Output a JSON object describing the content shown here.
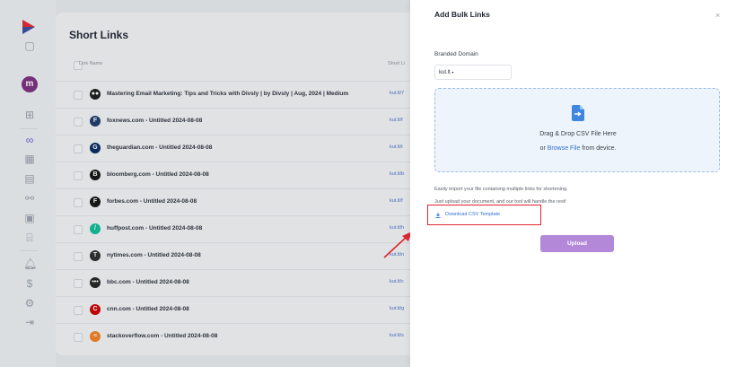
{
  "sidebar": {
    "avatar_letter": "m",
    "dollar_glyph": "$"
  },
  "page": {
    "title": "Short Links",
    "col_link_name": "Link Name",
    "col_short_link": "Short Li"
  },
  "rows": [
    {
      "name": "Mastering Email Marketing: Tips and Tricks with Divsly | by Divsly | Aug, 2024 | Medium",
      "url": "kut.lt/7",
      "icon": "medium-icon",
      "color": "#1a1a1a",
      "glyph": "●●"
    },
    {
      "name": "foxnews.com - Untitled 2024-08-08",
      "url": "kut.lt/f",
      "icon": "foxnews-icon",
      "color": "#1b3a6b",
      "glyph": "F"
    },
    {
      "name": "theguardian.com - Untitled 2024-08-08",
      "url": "kut.lt/t",
      "icon": "guardian-icon",
      "color": "#052962",
      "glyph": "G"
    },
    {
      "name": "bloomberg.com - Untitled 2024-08-08",
      "url": "kut.lt/b",
      "icon": "bloomberg-icon",
      "color": "#111111",
      "glyph": "B"
    },
    {
      "name": "forbes.com - Untitled 2024-08-08",
      "url": "kut.lt/f",
      "icon": "forbes-icon",
      "color": "#111111",
      "glyph": "F"
    },
    {
      "name": "huffpost.com - Untitled 2024-08-08",
      "url": "kut.lt/h",
      "icon": "huffpost-icon",
      "color": "#0dbe98",
      "glyph": "/"
    },
    {
      "name": "nytimes.com - Untitled 2024-08-08",
      "url": "kut.lt/n",
      "icon": "nytimes-icon",
      "color": "#2b2b2b",
      "glyph": "T"
    },
    {
      "name": "bbc.com - Untitled 2024-08-08",
      "url": "kut.lt/c",
      "icon": "bbc-icon",
      "color": "#222222",
      "glyph": "•••"
    },
    {
      "name": "cnn.com - Untitled 2024-08-08",
      "url": "kut.lt/g",
      "icon": "cnn-icon",
      "color": "#cc0000",
      "glyph": "C"
    },
    {
      "name": "stackoverflow.com - Untitled 2024-08-08",
      "url": "kut.lt/s",
      "icon": "stackoverflow-icon",
      "color": "#f48024",
      "glyph": "≡"
    }
  ],
  "drawer": {
    "title": "Add Bulk Links",
    "close_glyph": "×",
    "domain_label": "Branded Domain",
    "domain_value": "kut.lt",
    "domain_caret": "▾",
    "dropzone_line1": "Drag & Drop CSV File Here",
    "dropzone_prefix": "or",
    "browse_label": "Browse File",
    "dropzone_suffix": "from device.",
    "hint_line1": "Easily import your file containing multiple links for shortening.",
    "hint_line2": "Just upload your document, and our tool will handle the rest!",
    "template_label": "Download CSV Template",
    "upload_label": "Upload"
  },
  "colors": {
    "accent_purple": "#b488d8",
    "link_blue": "#2f6fd2",
    "highlight_red": "#e0262e",
    "avatar_purple": "#7a2e7f"
  }
}
